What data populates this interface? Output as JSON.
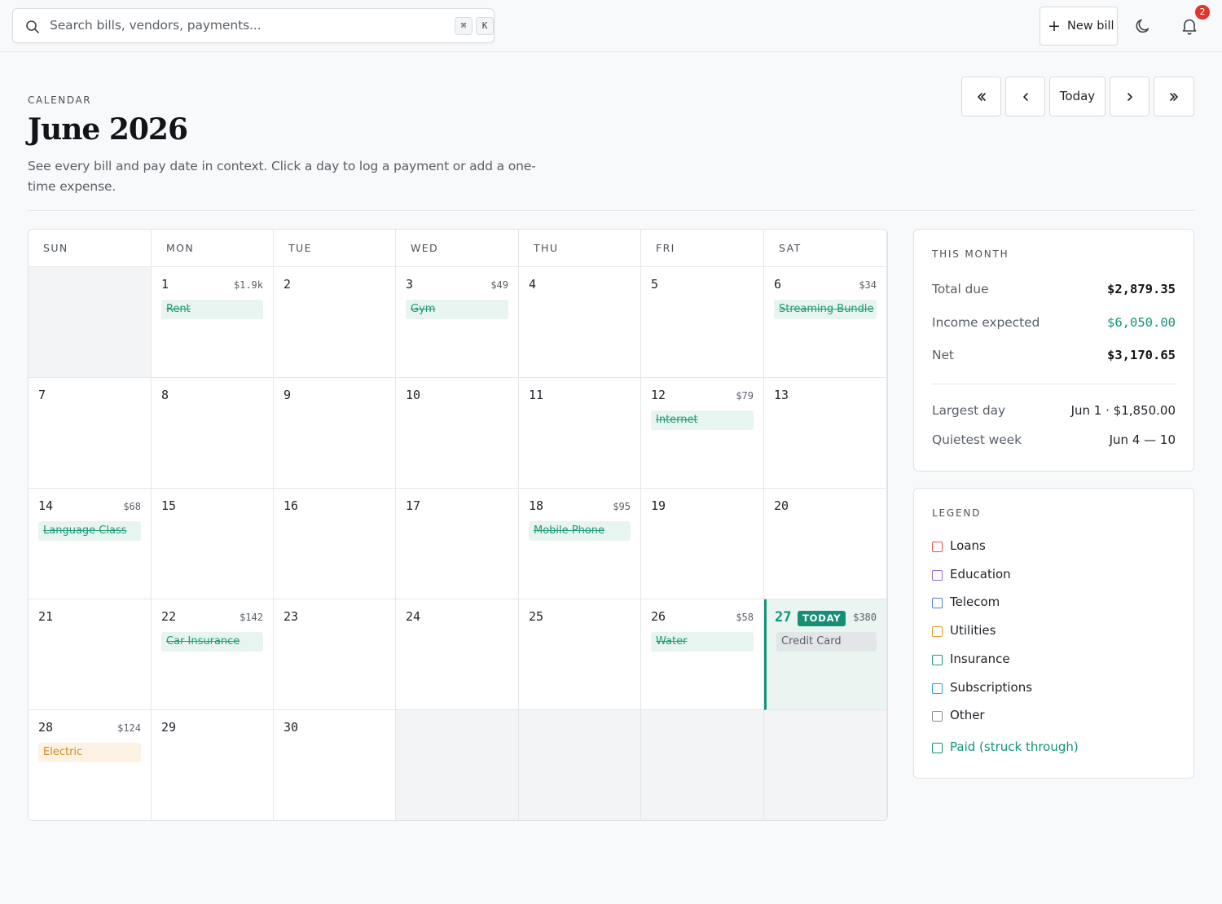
{
  "search": {
    "placeholder": "Search bills, vendors, payments...",
    "kbd": [
      "⌘",
      "K"
    ]
  },
  "header_actions": {
    "new_bill": "New bill",
    "notification_count": "2"
  },
  "page": {
    "eyebrow": "CALENDAR",
    "title": "June 2026",
    "subtitle": "See every bill and pay date in context. Click a day to log a payment or add a one-time expense."
  },
  "nav": {
    "today": "Today"
  },
  "calendar": {
    "weekdays": [
      "SUN",
      "MON",
      "TUE",
      "WED",
      "THU",
      "FRI",
      "SAT"
    ],
    "today_badge": "TODAY",
    "days": {
      "1": {
        "amount": "$1.9k",
        "bill": "Rent",
        "status": "paid"
      },
      "3": {
        "amount": "$49",
        "bill": "Gym",
        "status": "paid"
      },
      "6": {
        "amount": "$34",
        "bill": "Streaming Bundle",
        "status": "paid"
      },
      "12": {
        "amount": "$79",
        "bill": "Internet",
        "status": "paid"
      },
      "14": {
        "amount": "$68",
        "bill": "Language Class",
        "status": "paid"
      },
      "18": {
        "amount": "$95",
        "bill": "Mobile Phone",
        "status": "paid"
      },
      "22": {
        "amount": "$142",
        "bill": "Car Insurance",
        "status": "paid"
      },
      "26": {
        "amount": "$58",
        "bill": "Water",
        "status": "paid"
      },
      "27": {
        "amount": "$380",
        "bill": "Credit Card",
        "status": "upcoming"
      },
      "28": {
        "amount": "$124",
        "bill": "Electric",
        "status": "utility"
      }
    }
  },
  "this_month": {
    "title": "THIS MONTH",
    "total_due_label": "Total due",
    "total_due": "$2,879.35",
    "income_label": "Income expected",
    "income": "$6,050.00",
    "net_label": "Net",
    "net": "$3,170.65",
    "largest_day_label": "Largest day",
    "largest_day": "Jun 1 · $1,850.00",
    "quietest_week_label": "Quietest week",
    "quietest_week": "Jun 4 — 10"
  },
  "legend": {
    "title": "LEGEND",
    "items": [
      {
        "label": "Loans",
        "color": "#e0534a"
      },
      {
        "label": "Education",
        "color": "#9a67d8"
      },
      {
        "label": "Telecom",
        "color": "#4a7fd8"
      },
      {
        "label": "Utilities",
        "color": "#e09a2a"
      },
      {
        "label": "Insurance",
        "color": "#1f9b78"
      },
      {
        "label": "Subscriptions",
        "color": "#2aa4c8"
      },
      {
        "label": "Other",
        "color": "#8a9096"
      }
    ],
    "paid_label": "Paid (struck through)",
    "paid_color": "#139479"
  },
  "colors": {
    "accent": "#139479",
    "today_bg": "#eaf5f2",
    "badge_red": "#e0342c"
  }
}
